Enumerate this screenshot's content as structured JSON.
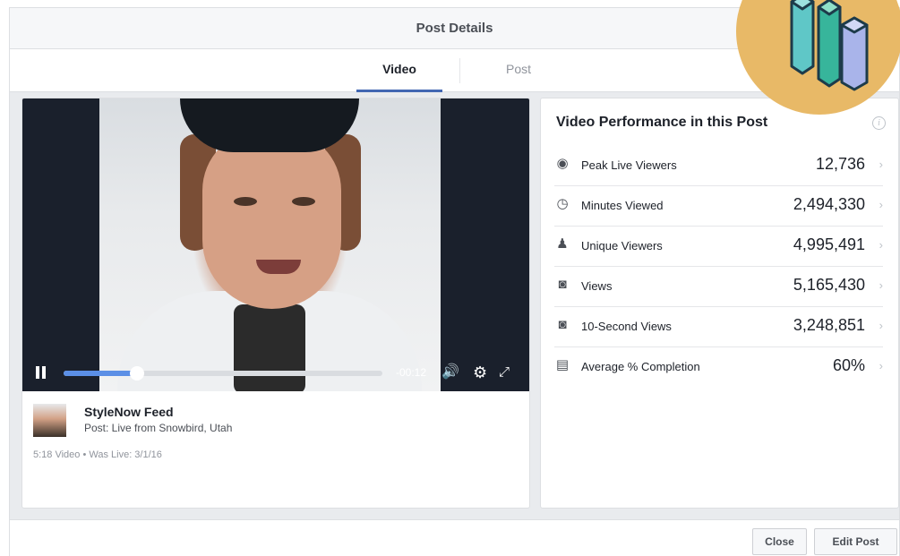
{
  "header": {
    "title": "Post Details"
  },
  "tabs": [
    {
      "label": "Video",
      "active": true
    },
    {
      "label": "Post",
      "active": false
    }
  ],
  "player": {
    "time_remaining": "-00:12",
    "progress": 0.23
  },
  "video": {
    "page_name": "StyleNow Feed",
    "post_title": "Post: Live from Snowbird, Utah",
    "meta": "5:18 Video  •  Was Live: 3/1/16"
  },
  "performance": {
    "title": "Video Performance in this Post",
    "info_icon": "i",
    "metrics": [
      {
        "icon": "broadcast-icon",
        "label": "Peak Live Viewers",
        "value": "12,736"
      },
      {
        "icon": "clock-icon",
        "label": "Minutes Viewed",
        "value": "2,494,330"
      },
      {
        "icon": "person-icon",
        "label": "Unique Viewers",
        "value": "4,995,491"
      },
      {
        "icon": "video-camera-icon",
        "label": "Views",
        "value": "5,165,430"
      },
      {
        "icon": "video-camera-icon",
        "label": "10-Second Views",
        "value": "3,248,851"
      },
      {
        "icon": "film-icon",
        "label": "Average % Completion",
        "value": "60%"
      }
    ]
  },
  "footer": {
    "close_label": "Close",
    "edit_label": "Edit Post"
  },
  "colors": {
    "accent": "#4267b2",
    "progress": "#5b8fe6",
    "badge": "#e8b967"
  }
}
